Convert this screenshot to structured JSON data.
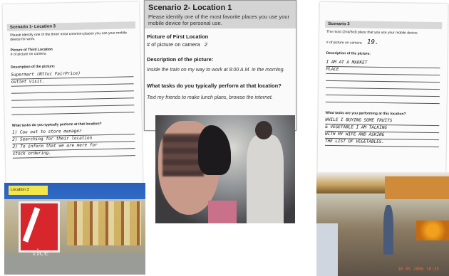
{
  "left_sheet": {
    "header": "Scenario 1- Location 3",
    "prompt": "Please identify one of the three most common places you use your mobile device for work.",
    "picture_label": "Picture of Third Location",
    "picture_number_label": "# of picture on camera",
    "description_label": "Description of the picture:",
    "description_lines": [
      "Supermart (Nttuc FairPrice)",
      "outlet visit."
    ],
    "tasks_label": "What tasks do you typically perform at that location?",
    "task_lines": [
      "1) Cau out to store manager",
      "2) Searching for their location",
      "3) To inform that we are mere for",
      "   stock ordering."
    ]
  },
  "center_sheet": {
    "title": "Scenario 2- Location 1",
    "prompt": "Please identify one of the most favorite places you use your mobile device for personal use.",
    "picture_label": "Picture of First Location",
    "picture_number_label": "# of picture on camera",
    "picture_number": "2",
    "description_label": "Description of the picture:",
    "description": "Inside the train on my way to work at 8:00 A.M. in the morning.",
    "tasks_label": "What tasks do you typically perform at that location?",
    "tasks": "Text my friends to make lunch plans, browse the internet."
  },
  "right_sheet": {
    "header": "Scenario 3",
    "prompt": "The most (2nd/3rd) place that you use your mobile device",
    "picture_number_label": "# of picture on camera",
    "picture_number": "19.",
    "description_label": "Description of the picture:",
    "description_lines": [
      "I AM AT A MARKET",
      "PLACE"
    ],
    "tasks_label": "What tasks are you performing at this location?",
    "task_lines": [
      "WHILE I BUYING SOME FRUITS",
      "& VEGETABLE I AM TALKING",
      "WITH MY WIFE AND ASKING",
      "THE LIST OF VEGETABLES."
    ]
  },
  "photos": {
    "store_caption": "Location 3",
    "store_sign_text": "rice",
    "market_timestamp": "16 05 2008 10:35"
  }
}
